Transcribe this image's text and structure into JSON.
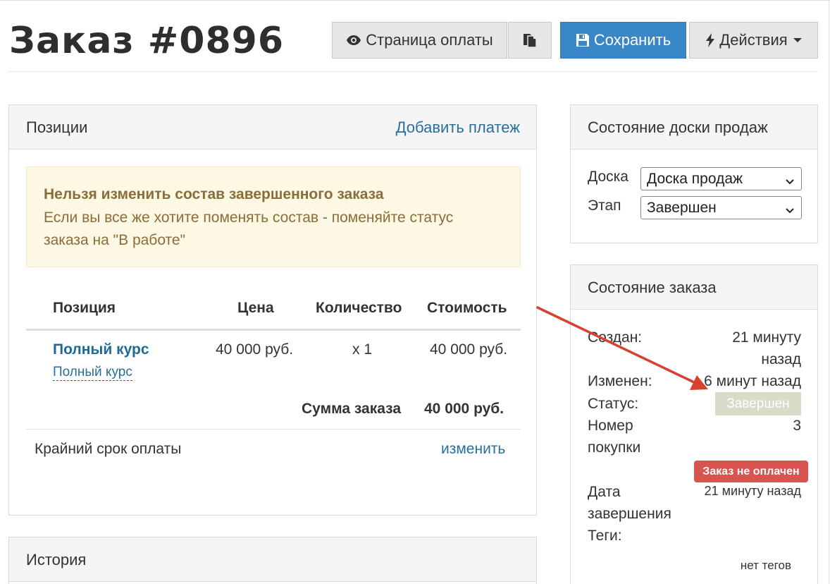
{
  "header": {
    "title": "Заказ #0896",
    "buttons": {
      "payment_page": "Страница оплаты",
      "save": "Сохранить",
      "actions": "Действия"
    }
  },
  "items_panel": {
    "title": "Позиции",
    "add_payment": "Добавить платеж",
    "warning": {
      "title": "Нельзя изменить состав завершенного заказа",
      "text": "Если вы все же хотите поменять состав - поменяйте статус заказа на \"В работе\""
    },
    "table": {
      "columns": [
        "Позиция",
        "Цена",
        "Количество",
        "Стоимость"
      ],
      "rows": [
        {
          "name": "Полный курс",
          "subname": "Полный курс",
          "price": "40 000 руб.",
          "qty": "x 1",
          "cost": "40 000 руб."
        }
      ],
      "total_label": "Сумма заказа",
      "total_value": "40 000 руб."
    },
    "deadline_label": "Крайний срок оплаты",
    "deadline_change": "изменить"
  },
  "history_panel": {
    "title": "История"
  },
  "board_panel": {
    "title": "Состояние доски продаж",
    "board_label": "Доска",
    "board_value": "Доска продаж",
    "stage_label": "Этап",
    "stage_value": "Завершен"
  },
  "order_panel": {
    "title": "Состояние заказа",
    "created_label": "Создан:",
    "created_value_1": "21 минуту",
    "created_value_2": "назад",
    "changed_label": "Изменен:",
    "changed_value": "6 минут назад",
    "status_label": "Статус:",
    "status_value": "Завершен",
    "purchase_label_1": "Номер",
    "purchase_label_2": "покупки",
    "purchase_value": "3",
    "unpaid_badge": "Заказ не оплачен",
    "completed_label_1": "Дата",
    "completed_label_2": "завершения",
    "completed_value": "21 минуту назад",
    "tags_label": "Теги:",
    "tags_value": "нет тегов"
  },
  "colors": {
    "primary": "#3a87c8",
    "link": "#2a6f9a",
    "warning_bg": "#fcf8e3",
    "warning_text": "#8a6d3b",
    "danger": "#d9534f",
    "annotation_arrow": "#d9412f"
  },
  "icons": {
    "payment_page": "eye-icon",
    "copy": "copy-icon",
    "save": "floppy-disk-icon",
    "actions": "lightning-bolt-icon"
  }
}
